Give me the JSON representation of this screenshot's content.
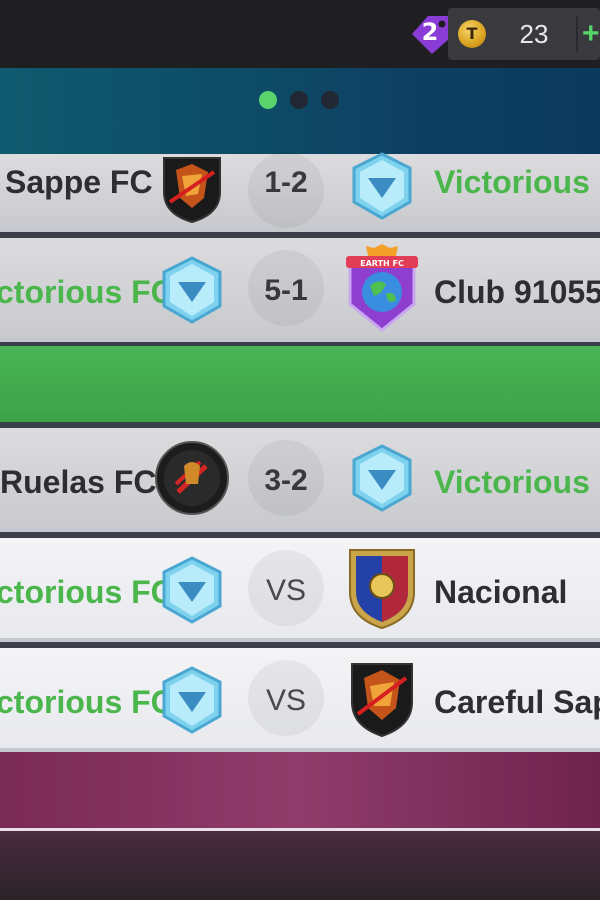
{
  "topbar": {
    "tag_count": "2",
    "coin_symbol": "T",
    "coin_amount": "23",
    "plus": "+"
  },
  "carousel": {
    "pages": 3,
    "active": 0
  },
  "matches": [
    {
      "home": "Sappe FC",
      "away": "Victorious F",
      "result": "1-2",
      "winner": "away"
    },
    {
      "home": "ctorious FC",
      "away": "Club 91055",
      "result": "5-1",
      "winner": "home"
    },
    {
      "home": "Ruelas FC",
      "away": "Victorious F",
      "result": "3-2",
      "winner": "away"
    },
    {
      "home": "ctorious FC",
      "away": "Nacional",
      "result": "VS",
      "winner": "home"
    },
    {
      "home": "ctorious FC",
      "away": "Careful Sap",
      "result": "VS",
      "winner": "home"
    }
  ],
  "crests": {
    "earth_fc_label": "EARTH FC"
  },
  "colors": {
    "green": "#4bb64c",
    "banner_blue": "#0d4c66",
    "band_green": "#49b454",
    "bottom_purple": "#8f3c6a"
  }
}
